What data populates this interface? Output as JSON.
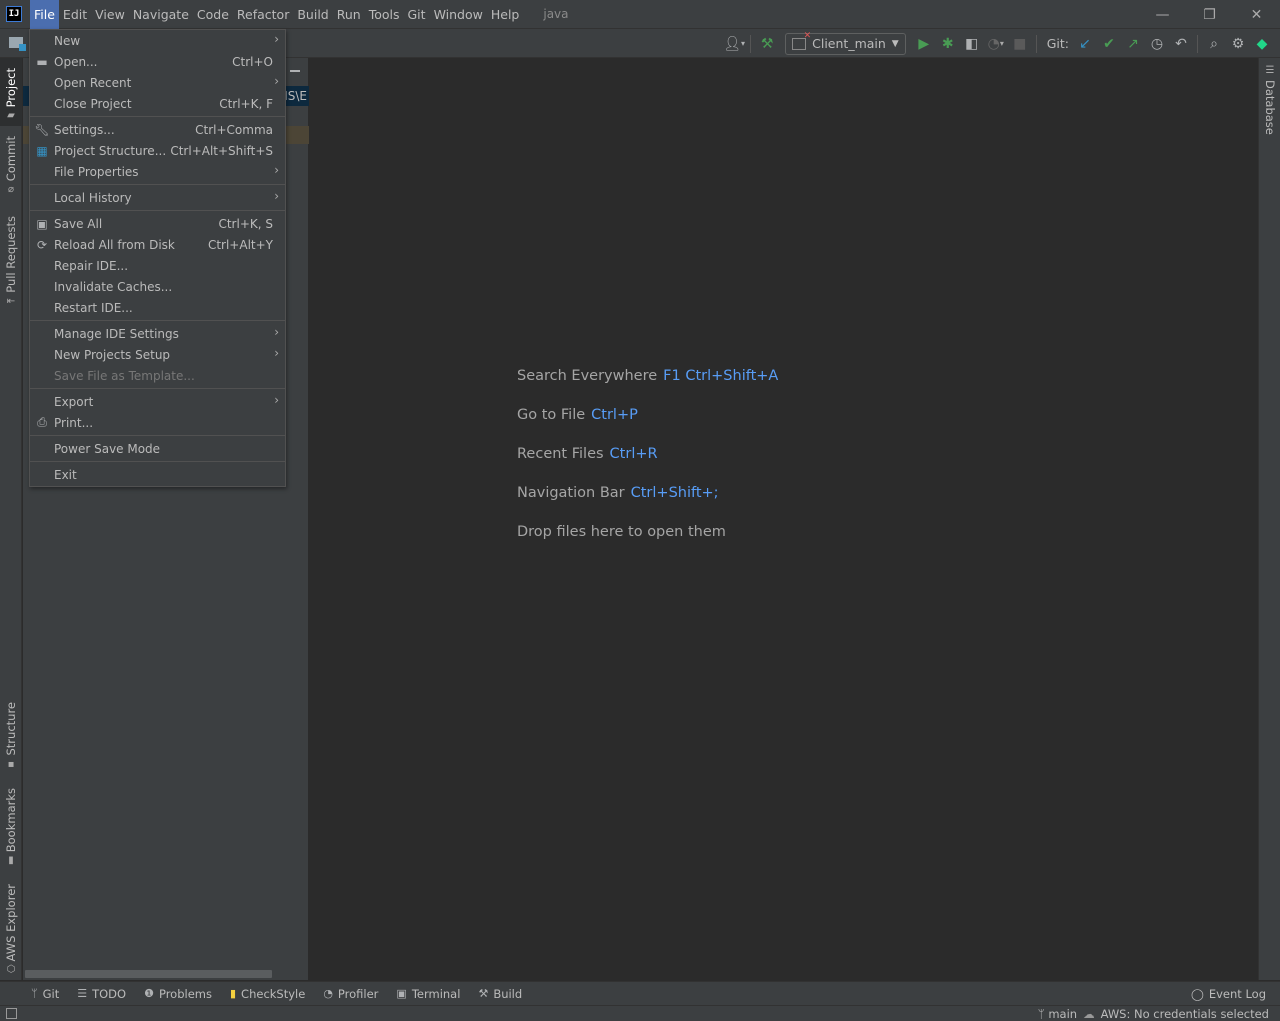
{
  "window": {
    "project_name": "java",
    "controls": {
      "minimize": "—",
      "restore": "❐",
      "close": "✕"
    }
  },
  "menubar": {
    "logo": "IJ",
    "items": [
      {
        "label": "File",
        "active": true
      },
      {
        "label": "Edit"
      },
      {
        "label": "View"
      },
      {
        "label": "Navigate"
      },
      {
        "label": "Code"
      },
      {
        "label": "Refactor"
      },
      {
        "label": "Build"
      },
      {
        "label": "Run"
      },
      {
        "label": "Tools"
      },
      {
        "label": "Git"
      },
      {
        "label": "Window"
      },
      {
        "label": "Help"
      }
    ]
  },
  "toolbar": {
    "run_config": "Client_main",
    "git_label": "Git:",
    "icons": [
      "user-icon",
      "build-hammer-icon",
      "run-icon",
      "debug-icon",
      "coverage-icon",
      "profile-icon",
      "stop-icon",
      "git-update-icon",
      "git-commit-icon",
      "git-push-icon",
      "history-icon",
      "rollback-icon",
      "search-icon",
      "settings-icon",
      "code-with-me-icon"
    ]
  },
  "file_menu": {
    "groups": [
      [
        {
          "label": "New",
          "submenu": true,
          "icon": ""
        },
        {
          "label": "Open...",
          "shortcut": "Ctrl+O",
          "icon": "folder-open-icon"
        },
        {
          "label": "Open Recent",
          "submenu": true
        },
        {
          "label": "Close Project",
          "shortcut": "Ctrl+K, F"
        }
      ],
      [
        {
          "label": "Settings...",
          "shortcut": "Ctrl+Comma",
          "icon": "wrench-icon"
        },
        {
          "label": "Project Structure...",
          "shortcut": "Ctrl+Alt+Shift+S",
          "icon": "project-structure-icon"
        },
        {
          "label": "File Properties",
          "submenu": true
        }
      ],
      [
        {
          "label": "Local History",
          "submenu": true
        }
      ],
      [
        {
          "label": "Save All",
          "shortcut": "Ctrl+K, S",
          "icon": "save-icon"
        },
        {
          "label": "Reload All from Disk",
          "shortcut": "Ctrl+Alt+Y",
          "icon": "reload-icon"
        },
        {
          "label": "Repair IDE..."
        },
        {
          "label": "Invalidate Caches..."
        },
        {
          "label": "Restart IDE..."
        }
      ],
      [
        {
          "label": "Manage IDE Settings",
          "submenu": true
        },
        {
          "label": "New Projects Setup",
          "submenu": true
        },
        {
          "label": "Save File as Template...",
          "disabled": true
        }
      ],
      [
        {
          "label": "Export",
          "submenu": true
        },
        {
          "label": "Print...",
          "icon": "print-icon"
        }
      ],
      [
        {
          "label": "Power Save Mode"
        }
      ],
      [
        {
          "label": "Exit"
        }
      ]
    ]
  },
  "left_stripe": {
    "top": [
      {
        "label": "Project",
        "active": true
      },
      {
        "label": "Commit"
      },
      {
        "label": "Pull Requests"
      }
    ],
    "bottom": [
      {
        "label": "Structure"
      },
      {
        "label": "Bookmarks"
      },
      {
        "label": "AWS Explorer"
      }
    ]
  },
  "right_stripe": {
    "items": [
      {
        "label": "Database"
      }
    ]
  },
  "project_panel": {
    "path_fragment": "VIS\\E"
  },
  "editor": {
    "hints": [
      {
        "text": "Search Everywhere",
        "key": "F1 Ctrl+Shift+A"
      },
      {
        "text": "Go to File",
        "key": "Ctrl+P"
      },
      {
        "text": "Recent Files",
        "key": "Ctrl+R"
      },
      {
        "text": "Navigation Bar",
        "key": "Ctrl+Shift+;"
      },
      {
        "text": "Drop files here to open them",
        "key": ""
      }
    ]
  },
  "bottom_bar": {
    "tabs": [
      {
        "label": "Git",
        "icon": "git-branch-icon"
      },
      {
        "label": "TODO",
        "icon": "todo-list-icon"
      },
      {
        "label": "Problems",
        "icon": "problems-icon"
      },
      {
        "label": "CheckStyle",
        "icon": "checkstyle-icon"
      },
      {
        "label": "Profiler",
        "icon": "profiler-icon"
      },
      {
        "label": "Terminal",
        "icon": "terminal-icon"
      },
      {
        "label": "Build",
        "icon": "build-hammer-icon"
      }
    ],
    "event_log": "Event Log"
  },
  "status_bar": {
    "branch": "main",
    "aws": "AWS: No credentials selected"
  },
  "colors": {
    "accent": "#4b6eaf",
    "shortcut_blue": "#589df6",
    "run_green": "#499c54"
  }
}
